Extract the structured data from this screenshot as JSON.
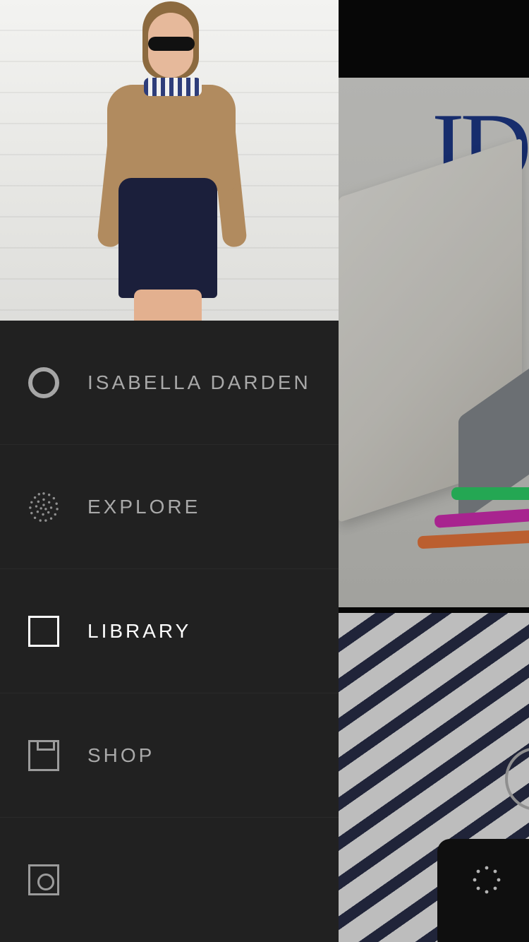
{
  "profile": {
    "name": "ISABELLA DARDEN"
  },
  "menu": {
    "items": [
      {
        "id": "profile",
        "label": "ISABELLA DARDEN",
        "icon": "circle-profile-icon",
        "active": false
      },
      {
        "id": "explore",
        "label": "EXPLORE",
        "icon": "dotted-circle-explore-icon",
        "active": false
      },
      {
        "id": "library",
        "label": "LIBRARY",
        "icon": "square-library-icon",
        "active": true
      },
      {
        "id": "shop",
        "label": "SHOP",
        "icon": "shop-box-icon",
        "active": false
      }
    ],
    "bottom": {
      "left_icon": "camera-icon",
      "right_icon": "settings-dots-icon"
    }
  },
  "colors": {
    "drawer_bg": "#212121",
    "text_inactive": "#a9a9a9",
    "text_active": "#ffffff",
    "divider": "#2a2a2a"
  }
}
